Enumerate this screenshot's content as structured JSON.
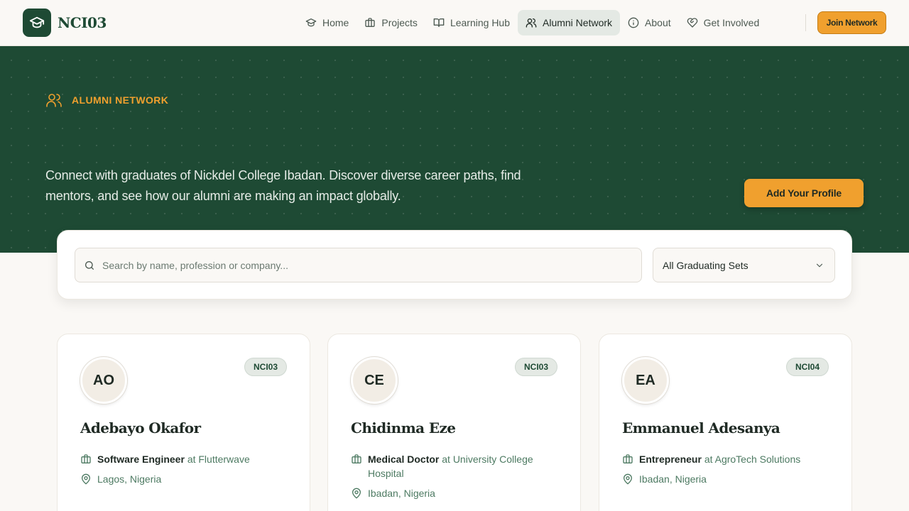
{
  "brand": {
    "name": "NCI03"
  },
  "nav": {
    "items": [
      {
        "label": "Home"
      },
      {
        "label": "Projects"
      },
      {
        "label": "Learning Hub"
      },
      {
        "label": "Alumni Network"
      },
      {
        "label": "About"
      },
      {
        "label": "Get Involved"
      }
    ],
    "active": "Alumni Network",
    "cta": "Join Network"
  },
  "hero": {
    "eyebrow": "ALUMNI NETWORK",
    "description": "Connect with graduates of Nickdel College Ibadan. Discover diverse career paths, find mentors, and see how our alumni are making an impact globally.",
    "cta": "Add Your Profile"
  },
  "search": {
    "placeholder": "Search by name, profession or company...",
    "value": "",
    "filter": {
      "selected": "All Graduating Sets"
    }
  },
  "alumni": [
    {
      "initials": "AO",
      "set": "NCI03",
      "name": "Adebayo Okafor",
      "role": "Software Engineer",
      "at": "at Flutterwave",
      "location": "Lagos, Nigeria"
    },
    {
      "initials": "CE",
      "set": "NCI03",
      "name": "Chidinma Eze",
      "role": "Medical Doctor",
      "at": "at University College Hospital",
      "location": "Ibadan, Nigeria"
    },
    {
      "initials": "EA",
      "set": "NCI04",
      "name": "Emmanuel Adesanya",
      "role": "Entrepreneur",
      "at": "at AgroTech Solutions",
      "location": "Ibadan, Nigeria"
    }
  ],
  "colors": {
    "primary": "#1e4a34",
    "accent": "#f0a02e",
    "background": "#faf8f5",
    "muted": "#4d7a62"
  }
}
